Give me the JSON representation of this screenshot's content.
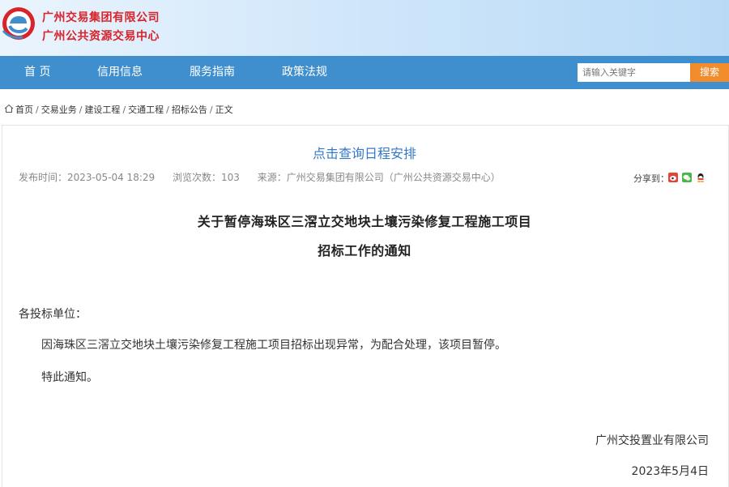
{
  "header": {
    "org_name_line1": "广州交易集团有限公司",
    "org_name_line2": "广州公共资源交易中心",
    "logo_icon": "e-logo-icon",
    "colors": {
      "brand_red": "#d8232a",
      "brand_blue": "#3f8fce",
      "accent_orange": "#f08c2c"
    }
  },
  "nav": {
    "items": [
      {
        "label": "首 页"
      },
      {
        "label": "信用信息"
      },
      {
        "label": "服务指南"
      },
      {
        "label": "政策法规"
      }
    ],
    "search": {
      "placeholder": "请输入关键字",
      "button_label": "搜索"
    }
  },
  "breadcrumb": {
    "home_icon": "home-icon",
    "items": [
      "首页",
      "交易业务",
      "建设工程",
      "交通工程",
      "招标公告",
      "正文"
    ],
    "separator": "/"
  },
  "article": {
    "schedule_link": "点击查询日程安排",
    "meta": {
      "publish_time": "发布时间：2023-05-04 18:29",
      "views": "浏览次数：103",
      "source": "来源：广州交易集团有限公司（广州公共资源交易中心）"
    },
    "share_label": "分享到：",
    "share_icons": [
      "weibo-icon",
      "wechat-icon",
      "qq-icon"
    ],
    "title_line1": "关于暂停海珠区三滘立交地块土壤污染修复工程施工项目",
    "title_line2": "招标工作的通知",
    "salutation": "各投标单位：",
    "paragraph1": "因海珠区三滘立交地块土壤污染修复工程施工项目招标出现异常，为配合处理，该项目暂停。",
    "paragraph2": "特此通知。",
    "signature": "广州交投置业有限公司",
    "date": "2023年5月4日"
  }
}
